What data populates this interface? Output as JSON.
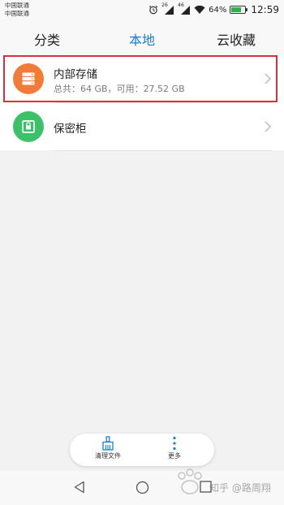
{
  "status_bar": {
    "carrier1": "中国联通",
    "carrier2": "中国联通",
    "net1": "26",
    "net2": "46",
    "battery_percent": "64%",
    "battery_level": 0.64,
    "time": "12:59"
  },
  "tabs": [
    {
      "label": "分类",
      "active": false
    },
    {
      "label": "本地",
      "active": true
    },
    {
      "label": "云收藏",
      "active": false
    }
  ],
  "list": [
    {
      "title": "内部存储",
      "subtitle": "总共：64 GB，可用：27.52 GB",
      "icon": "storage-icon",
      "highlighted": true
    },
    {
      "title": "保密柜",
      "icon": "safe-icon"
    }
  ],
  "bottom_toolbar": {
    "clean_label": "清理文件",
    "more_label": "更多"
  },
  "watermark": {
    "text": "知乎 @路周翔"
  },
  "colors": {
    "accent": "#1a7fd1",
    "storage_icon_bg": "#f27b3a",
    "safe_icon_bg": "#3bc167",
    "highlight_border": "#d9313a"
  }
}
